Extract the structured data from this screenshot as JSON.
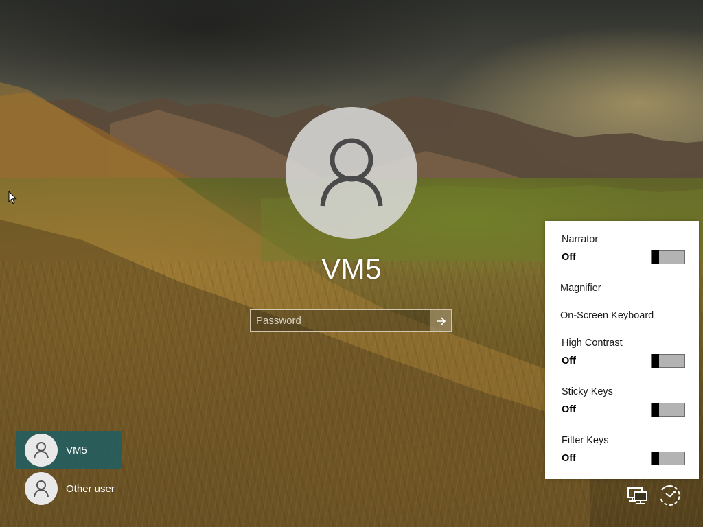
{
  "user": {
    "name": "VM5"
  },
  "password": {
    "placeholder": "Password",
    "value": ""
  },
  "user_list": [
    {
      "name": "VM5",
      "active": true
    },
    {
      "name": "Other user",
      "active": false
    }
  ],
  "ease_of_access": {
    "narrator": {
      "label": "Narrator",
      "state": "Off"
    },
    "magnifier": {
      "label": "Magnifier"
    },
    "on_screen_keyboard": {
      "label": "On-Screen Keyboard"
    },
    "high_contrast": {
      "label": "High Contrast",
      "state": "Off"
    },
    "sticky_keys": {
      "label": "Sticky Keys",
      "state": "Off"
    },
    "filter_keys": {
      "label": "Filter Keys",
      "state": "Off"
    }
  },
  "icons": {
    "network": "network-icon",
    "ease_of_access": "ease-of-access-icon",
    "submit": "arrow-right-icon"
  },
  "colors": {
    "active_tile": "#1e5f64",
    "panel_bg": "#ffffff",
    "toggle_track": "#b3b3b3"
  }
}
